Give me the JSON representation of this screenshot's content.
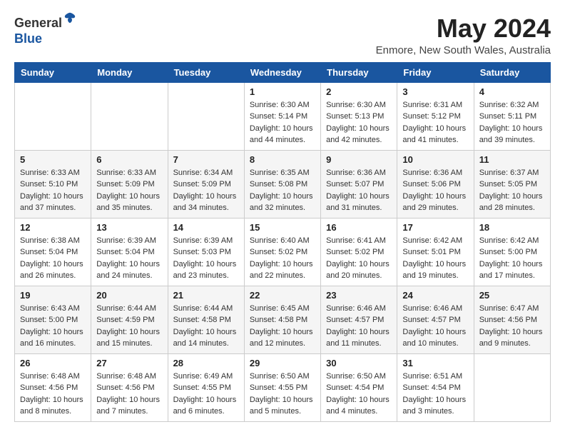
{
  "header": {
    "logo_line1": "General",
    "logo_line2": "Blue",
    "month_title": "May 2024",
    "location": "Enmore, New South Wales, Australia"
  },
  "weekdays": [
    "Sunday",
    "Monday",
    "Tuesday",
    "Wednesday",
    "Thursday",
    "Friday",
    "Saturday"
  ],
  "weeks": [
    [
      {
        "day": "",
        "info": ""
      },
      {
        "day": "",
        "info": ""
      },
      {
        "day": "",
        "info": ""
      },
      {
        "day": "1",
        "info": "Sunrise: 6:30 AM\nSunset: 5:14 PM\nDaylight: 10 hours\nand 44 minutes."
      },
      {
        "day": "2",
        "info": "Sunrise: 6:30 AM\nSunset: 5:13 PM\nDaylight: 10 hours\nand 42 minutes."
      },
      {
        "day": "3",
        "info": "Sunrise: 6:31 AM\nSunset: 5:12 PM\nDaylight: 10 hours\nand 41 minutes."
      },
      {
        "day": "4",
        "info": "Sunrise: 6:32 AM\nSunset: 5:11 PM\nDaylight: 10 hours\nand 39 minutes."
      }
    ],
    [
      {
        "day": "5",
        "info": "Sunrise: 6:33 AM\nSunset: 5:10 PM\nDaylight: 10 hours\nand 37 minutes."
      },
      {
        "day": "6",
        "info": "Sunrise: 6:33 AM\nSunset: 5:09 PM\nDaylight: 10 hours\nand 35 minutes."
      },
      {
        "day": "7",
        "info": "Sunrise: 6:34 AM\nSunset: 5:09 PM\nDaylight: 10 hours\nand 34 minutes."
      },
      {
        "day": "8",
        "info": "Sunrise: 6:35 AM\nSunset: 5:08 PM\nDaylight: 10 hours\nand 32 minutes."
      },
      {
        "day": "9",
        "info": "Sunrise: 6:36 AM\nSunset: 5:07 PM\nDaylight: 10 hours\nand 31 minutes."
      },
      {
        "day": "10",
        "info": "Sunrise: 6:36 AM\nSunset: 5:06 PM\nDaylight: 10 hours\nand 29 minutes."
      },
      {
        "day": "11",
        "info": "Sunrise: 6:37 AM\nSunset: 5:05 PM\nDaylight: 10 hours\nand 28 minutes."
      }
    ],
    [
      {
        "day": "12",
        "info": "Sunrise: 6:38 AM\nSunset: 5:04 PM\nDaylight: 10 hours\nand 26 minutes."
      },
      {
        "day": "13",
        "info": "Sunrise: 6:39 AM\nSunset: 5:04 PM\nDaylight: 10 hours\nand 24 minutes."
      },
      {
        "day": "14",
        "info": "Sunrise: 6:39 AM\nSunset: 5:03 PM\nDaylight: 10 hours\nand 23 minutes."
      },
      {
        "day": "15",
        "info": "Sunrise: 6:40 AM\nSunset: 5:02 PM\nDaylight: 10 hours\nand 22 minutes."
      },
      {
        "day": "16",
        "info": "Sunrise: 6:41 AM\nSunset: 5:02 PM\nDaylight: 10 hours\nand 20 minutes."
      },
      {
        "day": "17",
        "info": "Sunrise: 6:42 AM\nSunset: 5:01 PM\nDaylight: 10 hours\nand 19 minutes."
      },
      {
        "day": "18",
        "info": "Sunrise: 6:42 AM\nSunset: 5:00 PM\nDaylight: 10 hours\nand 17 minutes."
      }
    ],
    [
      {
        "day": "19",
        "info": "Sunrise: 6:43 AM\nSunset: 5:00 PM\nDaylight: 10 hours\nand 16 minutes."
      },
      {
        "day": "20",
        "info": "Sunrise: 6:44 AM\nSunset: 4:59 PM\nDaylight: 10 hours\nand 15 minutes."
      },
      {
        "day": "21",
        "info": "Sunrise: 6:44 AM\nSunset: 4:58 PM\nDaylight: 10 hours\nand 14 minutes."
      },
      {
        "day": "22",
        "info": "Sunrise: 6:45 AM\nSunset: 4:58 PM\nDaylight: 10 hours\nand 12 minutes."
      },
      {
        "day": "23",
        "info": "Sunrise: 6:46 AM\nSunset: 4:57 PM\nDaylight: 10 hours\nand 11 minutes."
      },
      {
        "day": "24",
        "info": "Sunrise: 6:46 AM\nSunset: 4:57 PM\nDaylight: 10 hours\nand 10 minutes."
      },
      {
        "day": "25",
        "info": "Sunrise: 6:47 AM\nSunset: 4:56 PM\nDaylight: 10 hours\nand 9 minutes."
      }
    ],
    [
      {
        "day": "26",
        "info": "Sunrise: 6:48 AM\nSunset: 4:56 PM\nDaylight: 10 hours\nand 8 minutes."
      },
      {
        "day": "27",
        "info": "Sunrise: 6:48 AM\nSunset: 4:56 PM\nDaylight: 10 hours\nand 7 minutes."
      },
      {
        "day": "28",
        "info": "Sunrise: 6:49 AM\nSunset: 4:55 PM\nDaylight: 10 hours\nand 6 minutes."
      },
      {
        "day": "29",
        "info": "Sunrise: 6:50 AM\nSunset: 4:55 PM\nDaylight: 10 hours\nand 5 minutes."
      },
      {
        "day": "30",
        "info": "Sunrise: 6:50 AM\nSunset: 4:54 PM\nDaylight: 10 hours\nand 4 minutes."
      },
      {
        "day": "31",
        "info": "Sunrise: 6:51 AM\nSunset: 4:54 PM\nDaylight: 10 hours\nand 3 minutes."
      },
      {
        "day": "",
        "info": ""
      }
    ]
  ]
}
